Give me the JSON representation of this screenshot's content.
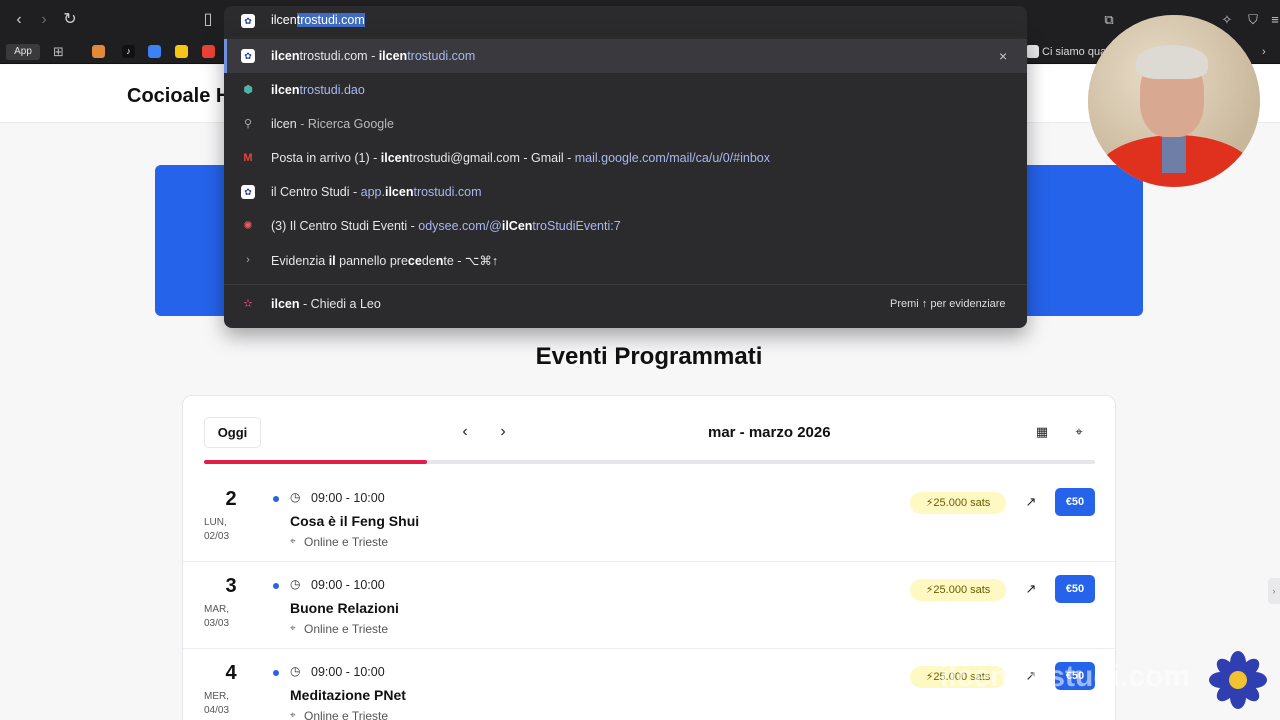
{
  "browser": {
    "address": {
      "typed": "ilcen",
      "completion": "trostudi.com"
    },
    "bookmarks": {
      "app_label": "App",
      "tab_label": "Ci siamo qua"
    }
  },
  "dropdown": {
    "suggestions": [
      {
        "strong": "ilcen",
        "rest": "trostudi.com",
        "sep": " - ",
        "url_strong": "ilcen",
        "url_rest": "trostudi.com",
        "icon": "site-favicon"
      },
      {
        "strong": "ilcen",
        "rest": "trostudi.dao",
        "icon": "cube-icon"
      },
      {
        "strong": "",
        "rest": "ilcen",
        "sep": " - ",
        "desc": "Ricerca Google",
        "icon": "search-icon"
      },
      {
        "strong": "",
        "rest": "Posta in arrivo (1) - ",
        "strong2": "ilcen",
        "rest2": "trostudi@gmail.com - Gmail",
        "sep": " - ",
        "url": "mail.google.com/mail/ca/u/0/#inbox",
        "icon": "gmail-icon"
      },
      {
        "strong": "",
        "rest": "il Centro Studi",
        "sep": " - ",
        "url_pre": "app.",
        "url_strong": "ilcen",
        "url_rest": "trostudi.com",
        "icon": "site-favicon"
      },
      {
        "strong": "",
        "rest": "(3) Il Centro Studi Eventi",
        "sep": " - ",
        "url_pre": "odysee.com/@",
        "url_strong": "ilCen",
        "url_rest": "troStudiEventi:7",
        "icon": "odysee-icon"
      },
      {
        "rest": "Evidenzia ",
        "strong": "il",
        "rest2": " pannello pre",
        "strong2": "ce",
        "rest3": "de",
        "strong3": "n",
        "rest4": "te - ⌥⌘↑",
        "icon": "chevron-right-icon"
      }
    ],
    "leo": {
      "strong": "ilcen",
      "rest": " - Chiedi a Leo",
      "hint": "Premi ↑ per evidenziare"
    }
  },
  "site": {
    "brand": "Cocioale H",
    "section_title": "Eventi Programmati",
    "calendar": {
      "today_label": "Oggi",
      "month_label": "mar - marzo 2026",
      "progress_fraction": 0.25
    },
    "events": [
      {
        "day": "2",
        "weekday": "LUN,",
        "date": "02/03",
        "time": "09:00  - 10:00",
        "title": "Cosa è il Feng Shui",
        "place": "Online e Trieste",
        "sats": "⚡25.000 sats",
        "price": "€50"
      },
      {
        "day": "3",
        "weekday": "MAR,",
        "date": "03/03",
        "time": "09:00  - 10:00",
        "title": "Buone Relazioni",
        "place": "Online e Trieste",
        "sats": "⚡25.000 sats",
        "price": "€50"
      },
      {
        "day": "4",
        "weekday": "MER,",
        "date": "04/03",
        "time": "09:00  - 10:00",
        "title": "Meditazione PNet",
        "place": "Online e Trieste",
        "sats": "⚡25.000 sats",
        "price": "€50"
      }
    ]
  },
  "overlay": {
    "watermark": "ilcentrostudi.com"
  },
  "colors": {
    "accent": "#2563eb",
    "progress": "#e11d48",
    "sats_bg": "#fef9c3"
  }
}
